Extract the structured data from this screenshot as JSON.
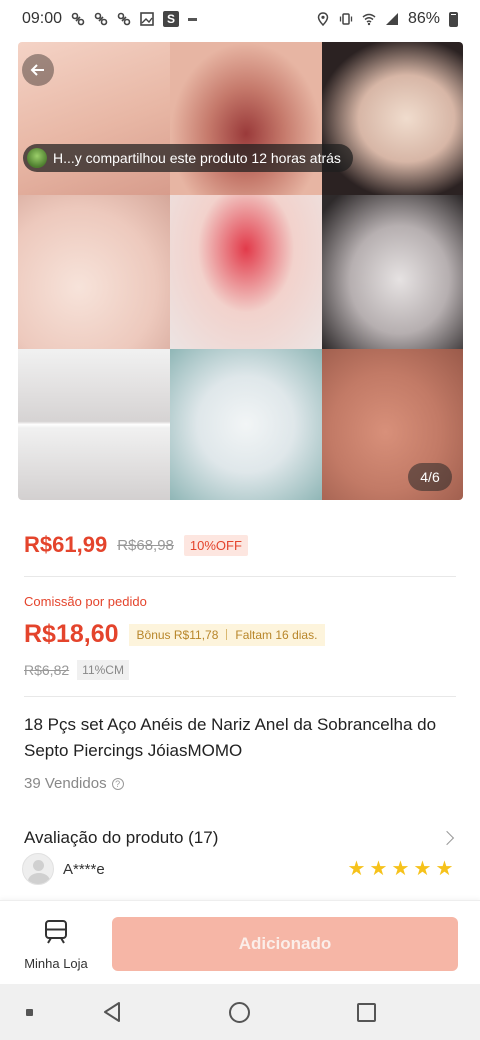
{
  "status_bar": {
    "time": "09:00",
    "battery": "86%",
    "notification_icons": [
      "link-icon",
      "link-icon",
      "link-icon",
      "image-icon",
      "s-app-icon",
      "dash-icon"
    ],
    "system_icons": [
      "location-icon",
      "vibrate-icon",
      "wifi-icon",
      "signal-icon",
      "battery-icon"
    ]
  },
  "gallery": {
    "share_banner": "H...y compartilhou este produto 12 horas atrás",
    "page_counter": "4/6"
  },
  "price": {
    "current": "R$61,99",
    "original": "R$68,98",
    "discount": "10%OFF"
  },
  "commission": {
    "label": "Comissão por pedido",
    "value": "R$18,60",
    "bonus": "Bônus R$11,78",
    "days_left": "Faltam 16 dias.",
    "old_value": "R$6,82",
    "cm_tag": "11%CM"
  },
  "product": {
    "title": "18 Pçs set Aço Anéis de Nariz Anel da Sobrancelha do Septo Piercings JóiasMOMO",
    "sold": "39 Vendidos"
  },
  "reviews": {
    "title": "Avaliação do produto (17)",
    "reviewer": "A****e",
    "rating": 5
  },
  "action_bar": {
    "my_store_label": "Minha Loja",
    "add_button_label": "Adicionado"
  },
  "colors": {
    "accent": "#e4442c",
    "button_disabled": "#f6b6a6",
    "star": "#f6c21b",
    "bonus_bg": "#fdf4dc"
  }
}
